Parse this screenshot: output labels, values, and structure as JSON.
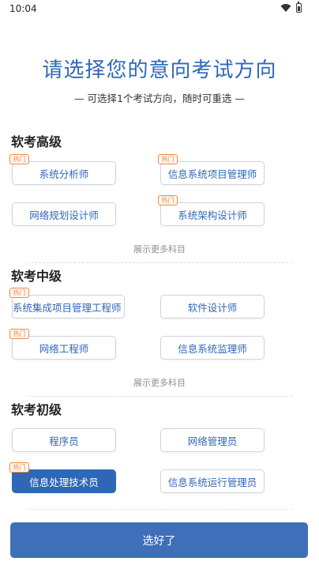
{
  "status": {
    "time": "10:04"
  },
  "header": {
    "title": "请选择您的意向考试方向",
    "subtitle": "— 可选择1个考试方向，随时可重选 —"
  },
  "hot_badge": "热门",
  "sections": [
    {
      "title": "软考高级",
      "more": "展示更多科目",
      "options": [
        {
          "label": "系统分析师",
          "hot": true
        },
        {
          "label": "信息系统项目管理师",
          "hot": true
        },
        {
          "label": "网络规划设计师",
          "hot": false
        },
        {
          "label": "系统架构设计师",
          "hot": true
        }
      ]
    },
    {
      "title": "软考中级",
      "more": "展示更多科目",
      "options": [
        {
          "label": "系统集成项目管理工程师",
          "hot": true
        },
        {
          "label": "软件设计师",
          "hot": false
        },
        {
          "label": "网络工程师",
          "hot": true
        },
        {
          "label": "信息系统监理师",
          "hot": false
        }
      ]
    },
    {
      "title": "软考初级",
      "options": [
        {
          "label": "程序员",
          "hot": false
        },
        {
          "label": "网络管理员",
          "hot": false
        },
        {
          "label": "信息处理技术员",
          "hot": true,
          "selected": true
        },
        {
          "label": "信息系统运行管理员",
          "hot": false
        }
      ]
    }
  ],
  "submit_label": "选好了",
  "colors": {
    "accent": "#2f67b7",
    "hot": "#f08b45",
    "button": "#3f6fb9"
  }
}
